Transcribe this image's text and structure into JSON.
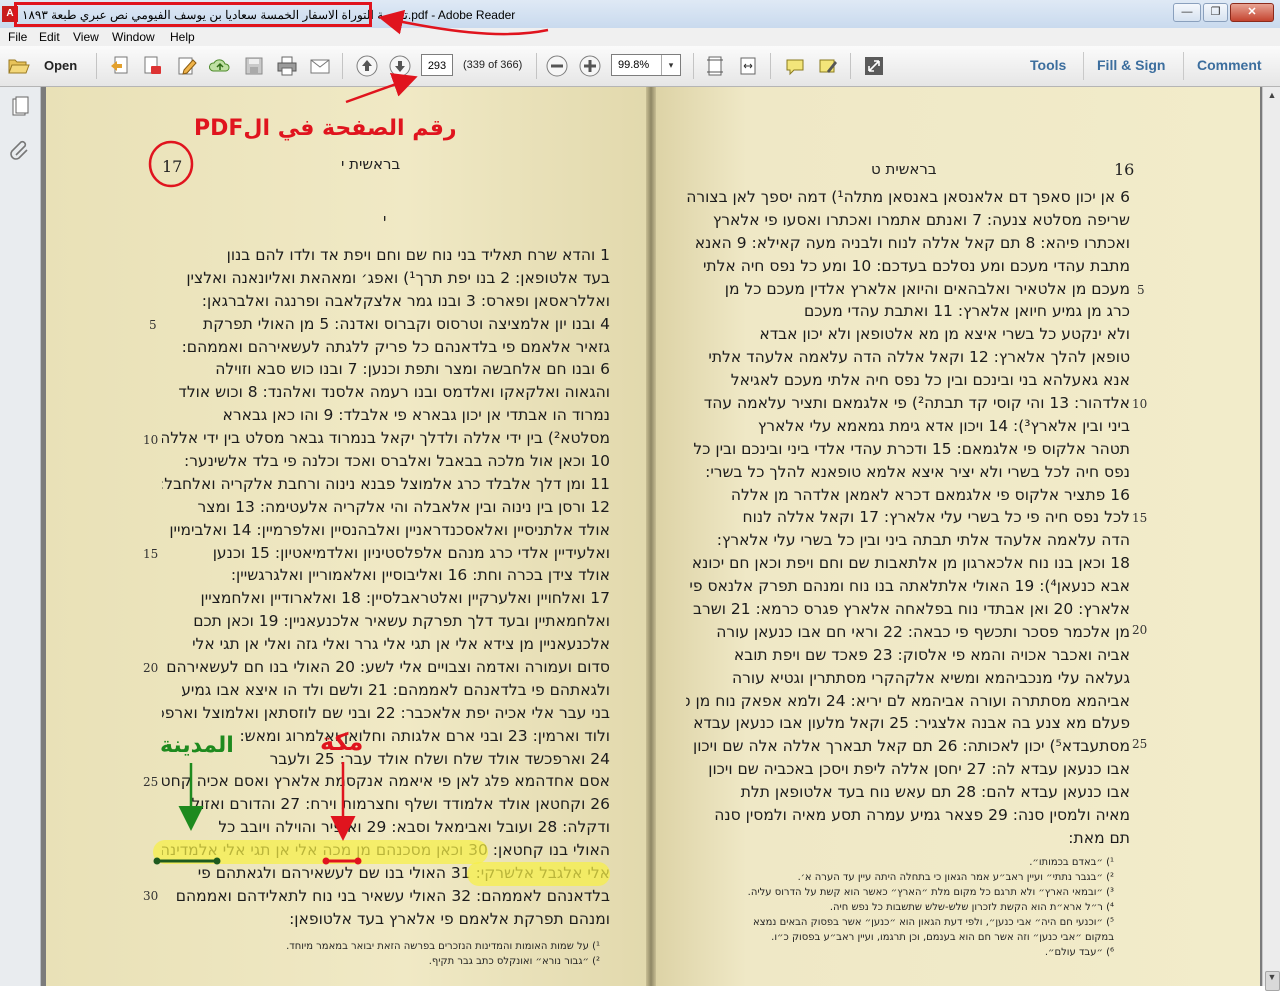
{
  "window": {
    "title": "ترجمة التوراة الاسفار الخمسة  سعاديا بن يوسف الفيومي نص عبري طبعة ١٨٩٣.pdf - Adobe Reader",
    "app_icon_label": "A",
    "minimize": "—",
    "restore": "❐",
    "close": "✕"
  },
  "menu": {
    "file": "File",
    "edit": "Edit",
    "view": "View",
    "window": "Window",
    "help": "Help"
  },
  "toolbar": {
    "open_label": "Open",
    "page_value": "293",
    "page_count": "(339 of 366)",
    "zoom_value": "99.8%",
    "zoom_dropdown": "▾",
    "tools": "Tools",
    "fill_sign": "Fill & Sign",
    "comment": "Comment"
  },
  "annotations": {
    "pdf_page_label": "رقم الصفحة في الPDF",
    "medina_label": "المدينة",
    "mecca_label": "مكة",
    "colors": {
      "red": "#e0141e",
      "green": "#1e8a1e",
      "highlight": "#f6f046"
    }
  },
  "left_page": {
    "page_number": "17",
    "running_head": "בראשית י",
    "chapter_mark": "י",
    "line_numbers": [
      "5",
      "10",
      "15",
      "20",
      "25",
      "30"
    ],
    "lines": [
      "1 והדא שרח תאליד בני נוח שם וחם ויפת אד ולדו להם בנון",
      "בעד אלטופאן: 2 בנו יפת תרך¹) ואפג׳ ומאהאת ואליונאנה ואלצין",
      "ואללראסאן ופארס: 3 ובנו גמר אלצקלאבה ופרנגה ואלברגאן:",
      "4 ובנו יון אלמציצה וטרסוס וקברוס ואדנה: 5 מן האולי תפרקת",
      "גזאיר אלאמם פי בלדאנהם כל פריק ללגתה לעשאירהם ואממהם:",
      "6 ובנו חם אלחבשה ומצר ותפת וכנען: 7 ובנו כוש סבא וזוילה",
      "והגאוה ואלקאקו ואלדמס ובנו רעמה אלסנד ואלהנד: 8 וכוש אולד",
      "נמרוד הו אבתדי אן יכון גבארא פי אלבלד: 9 והו כאן גבארא",
      "מסלטא²) בין ידי אללה ולדלך יקאל בנמרוד גבאר מסלט בין ידי אללה:",
      "10 וכאן אול מלכה בבאבל ואלברס ואכד וכלנה פי בלד אלשינער:",
      "11 ומן דלך אלבלד כרג אלמוצל פבנא נינוה ורחבת אלקריה ואלחבל:",
      "12 ורסן בין נינוה ובין אלאבלה והי אלקריה אלעטימה: 13 ומצר",
      "אולד אלתניסיין ואלאסכנדראניין ואלבהנסיין ואלפרמיין: 14 ואלבימיין",
      "ואלעידיין אלדי כרג מנהם אלפלסטיניון ואלדמיאטיון: 15 וכנען",
      "אולד צידן בכרה וחת: 16 ואליבוסיין ואלאמוריין ואלגרגשיין:",
      "17 ואלחויין ואלערקיין ואלטראבלסיין: 18 ואלארודיין ואלחמציין",
      "ואלחמאתיין ובעד דלך תפרקת עשאיר אלכנעאניין: 19 וכאן תכם",
      "אלכנעאניין מן צידא אלי אן תגי אלי גרר ואלי גזה ואלי אן תגי אלי",
      "סדום ועמורה ואדמה וצבויים אלי לשע: 20 האולי בנו חם לעשאירהם",
      "ולגאתהם פי בלדאנהם לאממהם: 21 ולשם ולד הו איצא אבו גמיע",
      "בני עבר אלי אכיה יפת אלאכבר: 22 ובני שם לוזסתאן ואלמוצל וארפכשד",
      "ולוד וארמין: 23 ובני ארם אלגותה וחלואן ואלמרוג ומאש:",
      "24 וארפכשד אולד שלח ושלח אולד עבר: 25 ולעבר",
      "אסם אחדהמא פלג לאן פי איאמה אנקסמת אלארץ ואסם אכיה קחטאן:",
      "26 וקחטאן אולד אלמודד ושלף וחצרמות וירח: 27 והדורם ואזול",
      "ודקלה: 28 ועובל ואבימאל וסבא: 29 ואופיר והוילה ויובב כל",
      "האולי בנו קחטאן: 30 וכאן מסכנהם מן מכה אלי אן תגי אלי אלמדינה",
      "אלי אלגבל אלשרקי: 31 האולי בנו שם לעשאירהם ולגאתהם פי",
      "בלדאנהם לאממהם: 32 האולי עשאיר בני נוח לתאלידהם ואממהם",
      "ומנהם תפרקת אלאמם פי אלארץ בעד אלטופאן:"
    ],
    "footnotes": [
      "¹) על שמות האומות והמדינות הנזכרים בפרשה הזאת יבואר במאמר מיוחד.",
      "²) ״גבור נורא״ ואונקלס כתב גבר תקיף."
    ]
  },
  "right_page": {
    "page_number": "16",
    "running_head": "בראשית ט",
    "line_numbers": [
      "5",
      "10",
      "15",
      "20",
      "25"
    ],
    "lines": [
      "6 אן יכון סאפך דם אלאנסאן באנסאן מתלה¹) דמה יספך לאן בצורה",
      "שריפה מסלטא צנעה: 7 ואנתם אתמרו ואכתרו ואסעו פי אלארץ",
      "ואכתרו פיהא: 8 תם קאל אללה לנוח ולבניה מעה קאילא: 9 האנא",
      "מתבת עהדי מעכם ומע נסלכם בעדכם: 10 ומע כל נפס חיה אלתי",
      "מעכם מן אלטאיר ואלבהאים והיואן אלארץ אלדין מעכם כל מן",
      "כרג מן גמיע חיואן אלארץ: 11 ואתבת עהדי מעכם",
      "ולא ינקטע כל בשרי איצא מן מא אלטופאן ולא יכון אבדא",
      "טופאן להלך אלארץ: 12 וקאל אללה הדה עלאמה אלעהד אלתי",
      "אנא גאעלהא בני ובינכם ובין כל נפס חיה אלתי מעכם לאגיאל",
      "אלדהור: 13 והי קוסי קד תבתה²) פי אלגמאם ותציר עלאמה עהד",
      "ביני ובין אלארץ³): 14 ויכון אדא גימת גמאמא עלי אלארץ",
      "תטהר אלקוס פי אלגמאם: 15 ודכרת עהדי אלדי ביני ובינכם ובין כל",
      "נפס חיה לכל בשרי ולא יציר איצא אלמא טופאנא להלך כל בשרי:",
      "16 פתציר אלקוס פי אלגמאם דכרא לאמאן אלדהר מן אללה",
      "לכל נפס חיה פי כל בשרי עלי אלארץ: 17 וקאל אללה לנוח",
      "הדה עלאמה אלעהד אלתי תבתה ביני ובין כל בשרי עלי אלארץ:",
      "18 וכאן בנו נוח אלכארגון מן אלתאבות שם וחם ויפת וכאן חם יכונא",
      "אבא כנעאן⁴): 19 האולי אלתלאתה בנו נוח ומנהם תפרק אלנאס פי",
      "אלארץ: 20 ואן אבתדי נוח בפלאחה אלארץ פגרס כרמא: 21 ושרב",
      "מן אלכמר פסכר ותכשף פי כבאה: 22 וראי חם אבו כנעאן עורה",
      "אביה ואכבר אכויה והמא פי אלסוק: 23 פאכד שם ויפת תובא",
      "געלאה עלי מנכביהמא ומשיא אלקהקרי מסתתרין וגטיא עורה",
      "אביהמא מסתתרה ועורה אביהמא לם יריא: 24 ולמא אפאק נוח מן סכרה",
      "פעלם מא צנע בה אבנה אלצגיר: 25 וקאל מלעון אבו כנעאן עבדא",
      "מסתעבדא⁵) יכון לאכותה: 26 תם קאל תבארך אללה אלה שם ויכון",
      "אבו כנעאן עבדא לה: 27 יחסן אללה ליפת ויסכן באכביה שם ויכון",
      "אבו כנעאן עבדא להם: 28 תם עאש נוח בעד אלטופאן תלת",
      "מאיה ולמסין סנה: 29 פצאר גמיע עמרה תסע מאיה ולמסין סנה",
      "תם מאת:"
    ],
    "footnotes": [
      "¹) ״באדם בכמותו״.",
      "²) ״בגבר נתתי״ ועיין ראב״ע אמר הגאון כי בתחלה היתה עיין עד הערה א׳.",
      "³) ״ובמאי הארץ״ ולא תרגם כל מקום מלת ״הארץ״ כאשר הוא קשת על הדרוס עליה.",
      "⁴) ר״ל ארא״ת הוא הקשת לזכרון שלש-שלש שתשבות כל נפש חיה.",
      "⁵) ״וכנעי חם היה״ אבי כנען״, ולפי דעת הגאון הוא ״כנען״ אשר בפסוק הבאים נמצא",
      "במקום ״אבי כנען״ וזה אשר חם הוא בענמם, וכן תרגמו, ועיין ראב״ע בפסוק כ״ו.",
      "⁶) ״עבד עולם״."
    ]
  }
}
